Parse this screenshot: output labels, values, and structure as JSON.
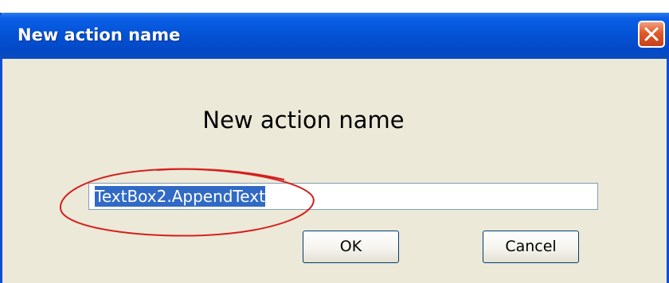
{
  "window": {
    "title": "New action name"
  },
  "dialog": {
    "heading": "New action name",
    "input_value": "TextBox2.AppendText",
    "ok_label": "OK",
    "cancel_label": "Cancel"
  },
  "icons": {
    "close": "close-icon",
    "annotation": "red-ellipse-highlight"
  },
  "colors": {
    "titlebar": "#0453d6",
    "dialog_bg": "#ece9d8",
    "selection": "#316ac5",
    "close_button": "#e05a2a",
    "annotation": "#d42020"
  }
}
